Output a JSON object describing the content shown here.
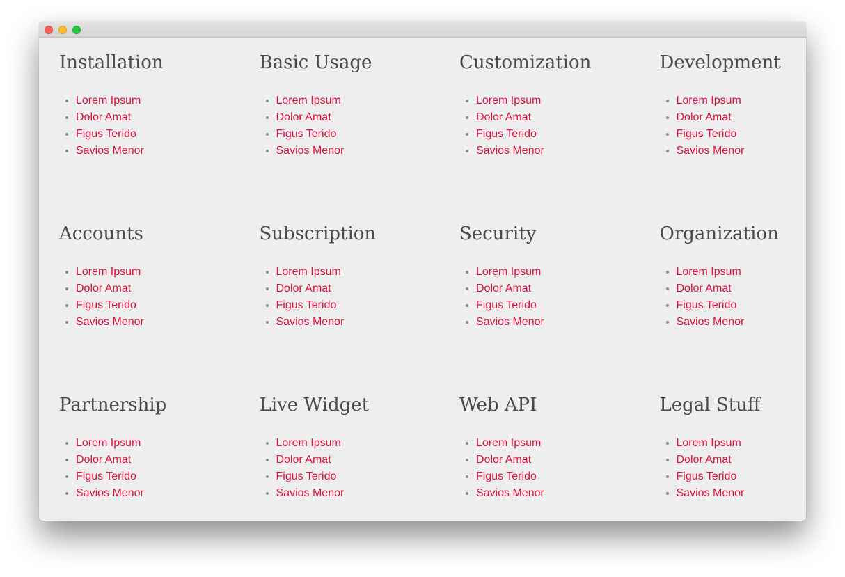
{
  "window": {
    "controls": {
      "close": "close-button",
      "minimize": "minimize-button",
      "maximize": "maximize-button"
    }
  },
  "colors": {
    "background": "#eeeeee",
    "heading": "#4a4a4a",
    "link": "#e0123e",
    "bullet": "#8c8c8c"
  },
  "sections": [
    {
      "title": "Installation",
      "links": [
        "Lorem Ipsum",
        "Dolor Amat",
        "Figus Terido",
        "Savios Menor"
      ]
    },
    {
      "title": "Basic Usage",
      "links": [
        "Lorem Ipsum",
        "Dolor Amat",
        "Figus Terido",
        "Savios Menor"
      ]
    },
    {
      "title": "Customization",
      "links": [
        "Lorem Ipsum",
        "Dolor Amat",
        "Figus Terido",
        "Savios Menor"
      ]
    },
    {
      "title": "Development",
      "links": [
        "Lorem Ipsum",
        "Dolor Amat",
        "Figus Terido",
        "Savios Menor"
      ]
    },
    {
      "title": "Accounts",
      "links": [
        "Lorem Ipsum",
        "Dolor Amat",
        "Figus Terido",
        "Savios Menor"
      ]
    },
    {
      "title": "Subscription",
      "links": [
        "Lorem Ipsum",
        "Dolor Amat",
        "Figus Terido",
        "Savios Menor"
      ]
    },
    {
      "title": "Security",
      "links": [
        "Lorem Ipsum",
        "Dolor Amat",
        "Figus Terido",
        "Savios Menor"
      ]
    },
    {
      "title": "Organization",
      "links": [
        "Lorem Ipsum",
        "Dolor Amat",
        "Figus Terido",
        "Savios Menor"
      ]
    },
    {
      "title": "Partnership",
      "links": [
        "Lorem Ipsum",
        "Dolor Amat",
        "Figus Terido",
        "Savios Menor"
      ]
    },
    {
      "title": "Live Widget",
      "links": [
        "Lorem Ipsum",
        "Dolor Amat",
        "Figus Terido",
        "Savios Menor"
      ]
    },
    {
      "title": "Web API",
      "links": [
        "Lorem Ipsum",
        "Dolor Amat",
        "Figus Terido",
        "Savios Menor"
      ]
    },
    {
      "title": "Legal Stuff",
      "links": [
        "Lorem Ipsum",
        "Dolor Amat",
        "Figus Terido",
        "Savios Menor"
      ]
    }
  ]
}
